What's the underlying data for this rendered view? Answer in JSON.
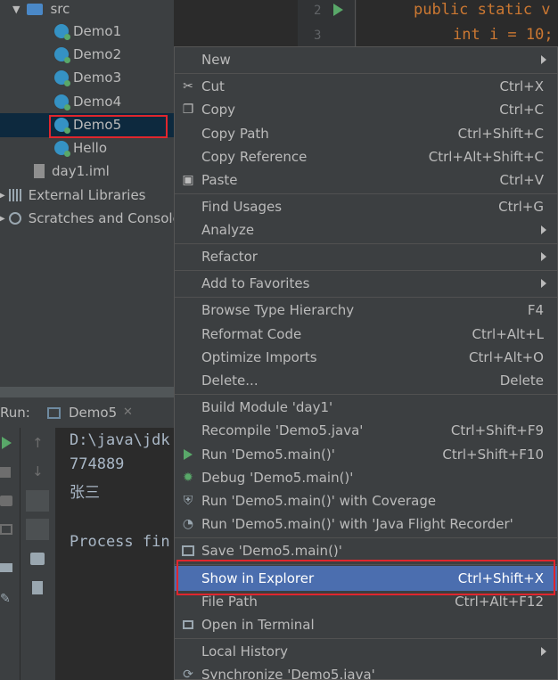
{
  "tree": {
    "src": "src",
    "items": [
      "Demo1",
      "Demo2",
      "Demo3",
      "Demo4",
      "Demo5",
      "Hello"
    ],
    "iml": "day1.iml",
    "external": "External Libraries",
    "scratches": "Scratches and Consoles"
  },
  "editor": {
    "line2": "2",
    "line3": "3",
    "code2": "public static v",
    "code3": "int i = 10;"
  },
  "run": {
    "label": "Run:",
    "tab": "Demo5",
    "console_lines": [
      "D:\\java\\jdk",
      "774889",
      "张三",
      "",
      "Process fin"
    ]
  },
  "menu": {
    "items": [
      {
        "label": "New",
        "shortcut": "",
        "submenu": true
      },
      {
        "label": "Cut",
        "shortcut": "Ctrl+X",
        "icon": "scissors-icon"
      },
      {
        "label": "Copy",
        "shortcut": "Ctrl+C",
        "icon": "copy-icon"
      },
      {
        "label": "Copy Path",
        "shortcut": "Ctrl+Shift+C"
      },
      {
        "label": "Copy Reference",
        "shortcut": "Ctrl+Alt+Shift+C"
      },
      {
        "label": "Paste",
        "shortcut": "Ctrl+V",
        "icon": "paste-icon"
      },
      {
        "label": "Find Usages",
        "shortcut": "Ctrl+G"
      },
      {
        "label": "Analyze",
        "shortcut": "",
        "submenu": true
      },
      {
        "label": "Refactor",
        "shortcut": "",
        "submenu": true
      },
      {
        "label": "Add to Favorites",
        "shortcut": "",
        "submenu": true
      },
      {
        "label": "Browse Type Hierarchy",
        "shortcut": "F4"
      },
      {
        "label": "Reformat Code",
        "shortcut": "Ctrl+Alt+L"
      },
      {
        "label": "Optimize Imports",
        "shortcut": "Ctrl+Alt+O"
      },
      {
        "label": "Delete...",
        "shortcut": "Delete"
      },
      {
        "label": "Build Module 'day1'",
        "shortcut": ""
      },
      {
        "label": "Recompile 'Demo5.java'",
        "shortcut": "Ctrl+Shift+F9"
      },
      {
        "label": "Run 'Demo5.main()'",
        "shortcut": "Ctrl+Shift+F10",
        "icon": "run-icon"
      },
      {
        "label": "Debug 'Demo5.main()'",
        "shortcut": "",
        "icon": "debug-icon"
      },
      {
        "label": "Run 'Demo5.main()' with Coverage",
        "shortcut": "",
        "icon": "coverage-icon"
      },
      {
        "label": "Run 'Demo5.main()' with 'Java Flight Recorder'",
        "shortcut": "",
        "icon": "profiler-icon"
      },
      {
        "label": "Save 'Demo5.main()'",
        "shortcut": "",
        "icon": "save-icon"
      },
      {
        "label": "Show in Explorer",
        "shortcut": "Ctrl+Shift+X",
        "highlighted": true
      },
      {
        "label": "File Path",
        "shortcut": "Ctrl+Alt+F12"
      },
      {
        "label": "Open in Terminal",
        "shortcut": "",
        "icon": "terminal-icon"
      },
      {
        "label": "Local History",
        "shortcut": "",
        "submenu": true
      },
      {
        "label": "Synchronize 'Demo5.java'",
        "shortcut": "",
        "icon": "sync-icon"
      }
    ]
  },
  "colors": {
    "highlight": "#4b6eaf",
    "annotation": "#e0262d",
    "run_green": "#59a869",
    "class_blue": "#3592c4"
  }
}
